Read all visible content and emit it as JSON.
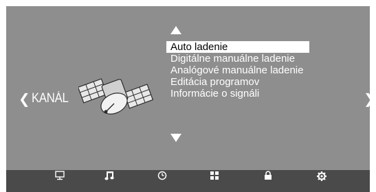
{
  "left_nav": {
    "label": "KANÁL"
  },
  "menu": {
    "items": [
      {
        "label": "Auto ladenie",
        "selected": true
      },
      {
        "label": "Digitálne manuálne ladenie",
        "selected": false
      },
      {
        "label": "Analógové manuálne ladenie",
        "selected": false
      },
      {
        "label": "Editácia programov",
        "selected": false
      },
      {
        "label": "Informácie o signáli",
        "selected": false
      }
    ]
  },
  "bottom_bar": {
    "icons": [
      "monitor-icon",
      "music-note-icon",
      "clock-icon",
      "grid-icon",
      "lock-icon",
      "gear-icon"
    ]
  },
  "colors": {
    "panel": "#8e8e8e",
    "bar": "#4a4a4a",
    "highlight": "#ffffff",
    "text": "#ffffff"
  }
}
